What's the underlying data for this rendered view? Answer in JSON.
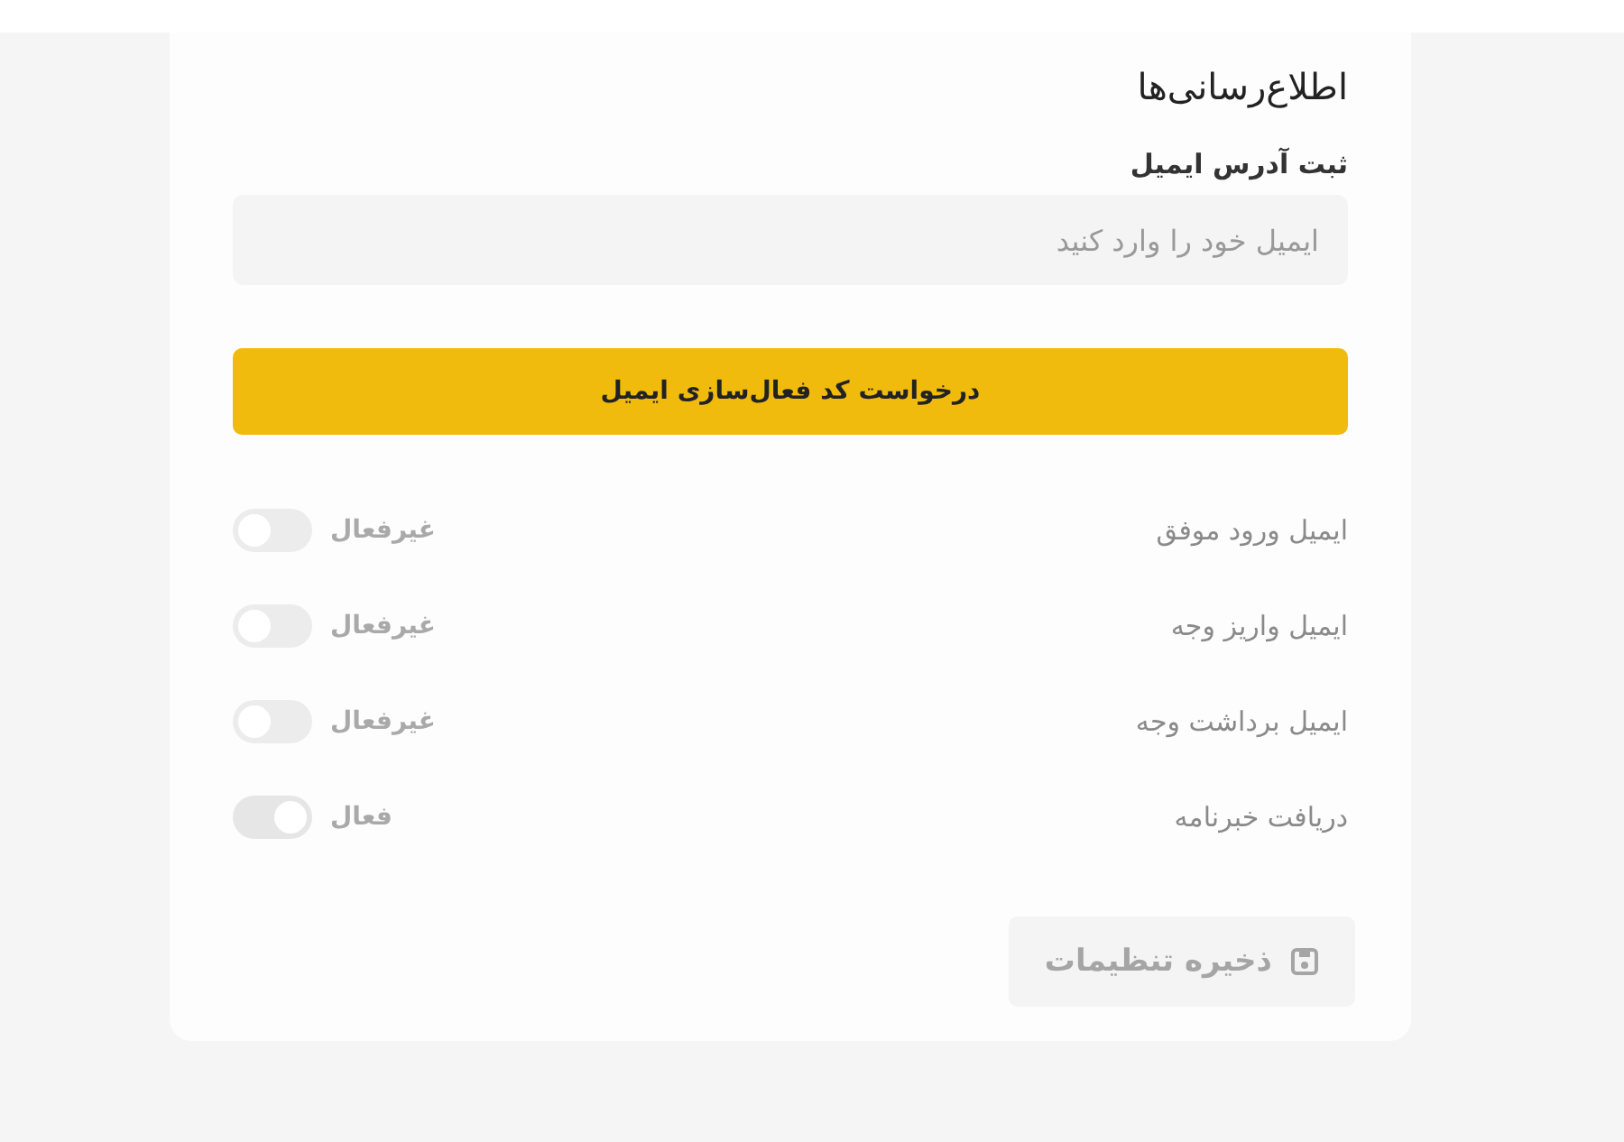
{
  "title": "اطلاع‌رسانی‌ها",
  "email": {
    "label": "ثبت آدرس ایمیل",
    "placeholder": "ایمیل خود را وارد کنید"
  },
  "request_button": {
    "label": "درخواست کد فعال‌سازی ایمیل"
  },
  "toggles": [
    {
      "label": "ایمیل ورود موفق",
      "state_text": "غیرفعال",
      "on": false,
      "disabled": true
    },
    {
      "label": "ایمیل واریز وجه",
      "state_text": "غیرفعال",
      "on": false,
      "disabled": true
    },
    {
      "label": "ایمیل برداشت وجه",
      "state_text": "غیرفعال",
      "on": false,
      "disabled": true
    },
    {
      "label": "دریافت خبرنامه",
      "state_text": "فعال",
      "on": true,
      "disabled": true
    }
  ],
  "save_button": {
    "label": "ذخیره تنظیمات",
    "disabled": true
  }
}
